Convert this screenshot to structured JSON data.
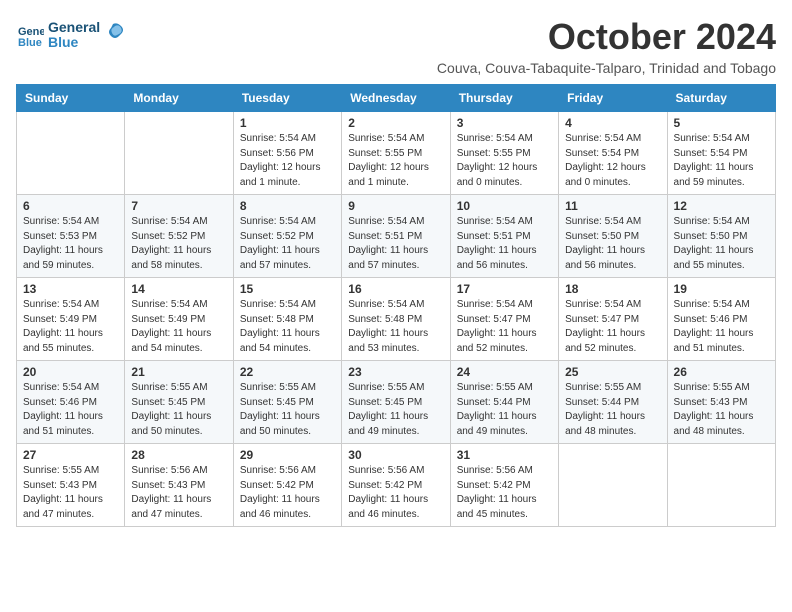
{
  "logo": {
    "line1": "General",
    "line2": "Blue"
  },
  "title": "October 2024",
  "subtitle": "Couva, Couva-Tabaquite-Talparo, Trinidad and Tobago",
  "days_of_week": [
    "Sunday",
    "Monday",
    "Tuesday",
    "Wednesday",
    "Thursday",
    "Friday",
    "Saturday"
  ],
  "weeks": [
    [
      {
        "day": "",
        "info": ""
      },
      {
        "day": "",
        "info": ""
      },
      {
        "day": "1",
        "info": "Sunrise: 5:54 AM\nSunset: 5:56 PM\nDaylight: 12 hours\nand 1 minute."
      },
      {
        "day": "2",
        "info": "Sunrise: 5:54 AM\nSunset: 5:55 PM\nDaylight: 12 hours\nand 1 minute."
      },
      {
        "day": "3",
        "info": "Sunrise: 5:54 AM\nSunset: 5:55 PM\nDaylight: 12 hours\nand 0 minutes."
      },
      {
        "day": "4",
        "info": "Sunrise: 5:54 AM\nSunset: 5:54 PM\nDaylight: 12 hours\nand 0 minutes."
      },
      {
        "day": "5",
        "info": "Sunrise: 5:54 AM\nSunset: 5:54 PM\nDaylight: 11 hours\nand 59 minutes."
      }
    ],
    [
      {
        "day": "6",
        "info": "Sunrise: 5:54 AM\nSunset: 5:53 PM\nDaylight: 11 hours\nand 59 minutes."
      },
      {
        "day": "7",
        "info": "Sunrise: 5:54 AM\nSunset: 5:52 PM\nDaylight: 11 hours\nand 58 minutes."
      },
      {
        "day": "8",
        "info": "Sunrise: 5:54 AM\nSunset: 5:52 PM\nDaylight: 11 hours\nand 57 minutes."
      },
      {
        "day": "9",
        "info": "Sunrise: 5:54 AM\nSunset: 5:51 PM\nDaylight: 11 hours\nand 57 minutes."
      },
      {
        "day": "10",
        "info": "Sunrise: 5:54 AM\nSunset: 5:51 PM\nDaylight: 11 hours\nand 56 minutes."
      },
      {
        "day": "11",
        "info": "Sunrise: 5:54 AM\nSunset: 5:50 PM\nDaylight: 11 hours\nand 56 minutes."
      },
      {
        "day": "12",
        "info": "Sunrise: 5:54 AM\nSunset: 5:50 PM\nDaylight: 11 hours\nand 55 minutes."
      }
    ],
    [
      {
        "day": "13",
        "info": "Sunrise: 5:54 AM\nSunset: 5:49 PM\nDaylight: 11 hours\nand 55 minutes."
      },
      {
        "day": "14",
        "info": "Sunrise: 5:54 AM\nSunset: 5:49 PM\nDaylight: 11 hours\nand 54 minutes."
      },
      {
        "day": "15",
        "info": "Sunrise: 5:54 AM\nSunset: 5:48 PM\nDaylight: 11 hours\nand 54 minutes."
      },
      {
        "day": "16",
        "info": "Sunrise: 5:54 AM\nSunset: 5:48 PM\nDaylight: 11 hours\nand 53 minutes."
      },
      {
        "day": "17",
        "info": "Sunrise: 5:54 AM\nSunset: 5:47 PM\nDaylight: 11 hours\nand 52 minutes."
      },
      {
        "day": "18",
        "info": "Sunrise: 5:54 AM\nSunset: 5:47 PM\nDaylight: 11 hours\nand 52 minutes."
      },
      {
        "day": "19",
        "info": "Sunrise: 5:54 AM\nSunset: 5:46 PM\nDaylight: 11 hours\nand 51 minutes."
      }
    ],
    [
      {
        "day": "20",
        "info": "Sunrise: 5:54 AM\nSunset: 5:46 PM\nDaylight: 11 hours\nand 51 minutes."
      },
      {
        "day": "21",
        "info": "Sunrise: 5:55 AM\nSunset: 5:45 PM\nDaylight: 11 hours\nand 50 minutes."
      },
      {
        "day": "22",
        "info": "Sunrise: 5:55 AM\nSunset: 5:45 PM\nDaylight: 11 hours\nand 50 minutes."
      },
      {
        "day": "23",
        "info": "Sunrise: 5:55 AM\nSunset: 5:45 PM\nDaylight: 11 hours\nand 49 minutes."
      },
      {
        "day": "24",
        "info": "Sunrise: 5:55 AM\nSunset: 5:44 PM\nDaylight: 11 hours\nand 49 minutes."
      },
      {
        "day": "25",
        "info": "Sunrise: 5:55 AM\nSunset: 5:44 PM\nDaylight: 11 hours\nand 48 minutes."
      },
      {
        "day": "26",
        "info": "Sunrise: 5:55 AM\nSunset: 5:43 PM\nDaylight: 11 hours\nand 48 minutes."
      }
    ],
    [
      {
        "day": "27",
        "info": "Sunrise: 5:55 AM\nSunset: 5:43 PM\nDaylight: 11 hours\nand 47 minutes."
      },
      {
        "day": "28",
        "info": "Sunrise: 5:56 AM\nSunset: 5:43 PM\nDaylight: 11 hours\nand 47 minutes."
      },
      {
        "day": "29",
        "info": "Sunrise: 5:56 AM\nSunset: 5:42 PM\nDaylight: 11 hours\nand 46 minutes."
      },
      {
        "day": "30",
        "info": "Sunrise: 5:56 AM\nSunset: 5:42 PM\nDaylight: 11 hours\nand 46 minutes."
      },
      {
        "day": "31",
        "info": "Sunrise: 5:56 AM\nSunset: 5:42 PM\nDaylight: 11 hours\nand 45 minutes."
      },
      {
        "day": "",
        "info": ""
      },
      {
        "day": "",
        "info": ""
      }
    ]
  ]
}
